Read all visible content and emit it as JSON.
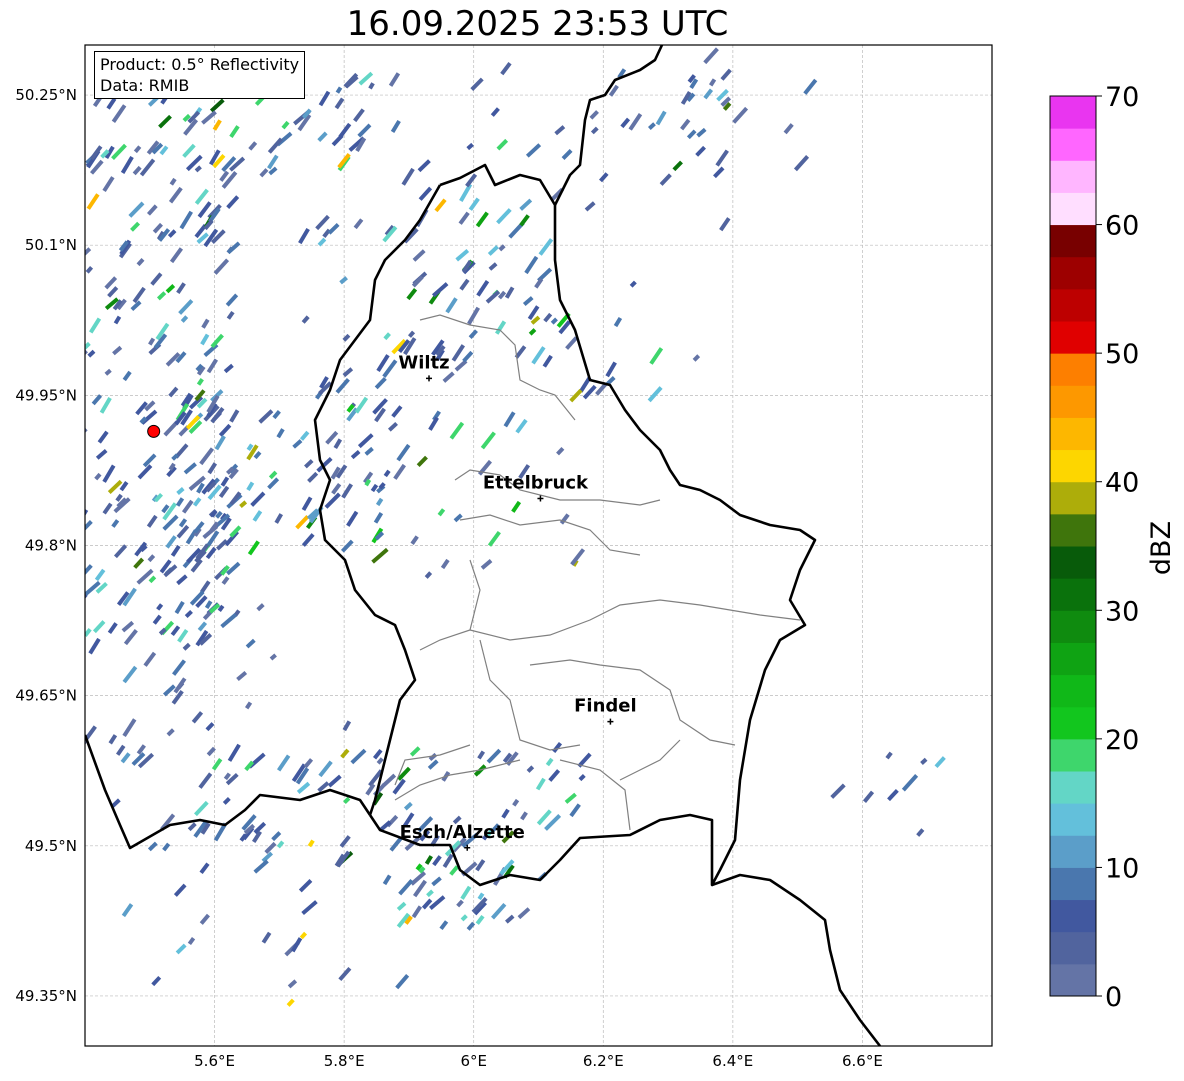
{
  "title": "16.09.2025 23:53 UTC",
  "info": {
    "product": "Product: 0.5° Reflectivity",
    "data": "Data: RMIB"
  },
  "map": {
    "lon_range": [
      5.4,
      6.8
    ],
    "lat_range": [
      49.3,
      50.3
    ],
    "lon_ticks": [
      {
        "v": 5.6,
        "label": "5.6°E"
      },
      {
        "v": 5.8,
        "label": "5.8°E"
      },
      {
        "v": 6.0,
        "label": "6°E"
      },
      {
        "v": 6.2,
        "label": "6.2°E"
      },
      {
        "v": 6.4,
        "label": "6.4°E"
      },
      {
        "v": 6.6,
        "label": "6.6°E"
      }
    ],
    "lat_ticks": [
      {
        "v": 50.25,
        "label": "50.25°N"
      },
      {
        "v": 50.1,
        "label": "50.1°N"
      },
      {
        "v": 49.95,
        "label": "49.95°N"
      },
      {
        "v": 49.8,
        "label": "49.8°N"
      },
      {
        "v": 49.65,
        "label": "49.65°N"
      },
      {
        "v": 49.5,
        "label": "49.5°N"
      },
      {
        "v": 49.35,
        "label": "49.35°N"
      }
    ],
    "cities": [
      {
        "name": "Wiltz",
        "lon": 5.931,
        "lat": 49.967
      },
      {
        "name": "Ettelbruck",
        "lon": 6.103,
        "lat": 49.847
      },
      {
        "name": "Findel",
        "lon": 6.211,
        "lat": 49.624
      },
      {
        "name": "Esch/Alzette",
        "lon": 5.99,
        "lat": 49.498
      }
    ],
    "radar_site": {
      "lon": 5.506,
      "lat": 49.914,
      "color": "#ff0000"
    }
  },
  "colorbar": {
    "label": "dBZ",
    "range": [
      0,
      70
    ],
    "ticks": [
      "0",
      "10",
      "20",
      "30",
      "40",
      "50",
      "60",
      "70"
    ],
    "colors": [
      "#6474a6",
      "#51649e",
      "#41589f",
      "#4a77ae",
      "#5b9ec9",
      "#63c0db",
      "#63d6c6",
      "#3ed66c",
      "#12c61e",
      "#10b818",
      "#0fa313",
      "#0f8b0f",
      "#0a720c",
      "#085b0a",
      "#3f750c",
      "#adad0a",
      "#fdd600",
      "#fdb700",
      "#fd9800",
      "#fd7f00",
      "#e00000",
      "#bd0000",
      "#9d0000",
      "#780000",
      "#ffdeff",
      "#ffb6ff",
      "#ff66ff",
      "#e935f0"
    ]
  }
}
